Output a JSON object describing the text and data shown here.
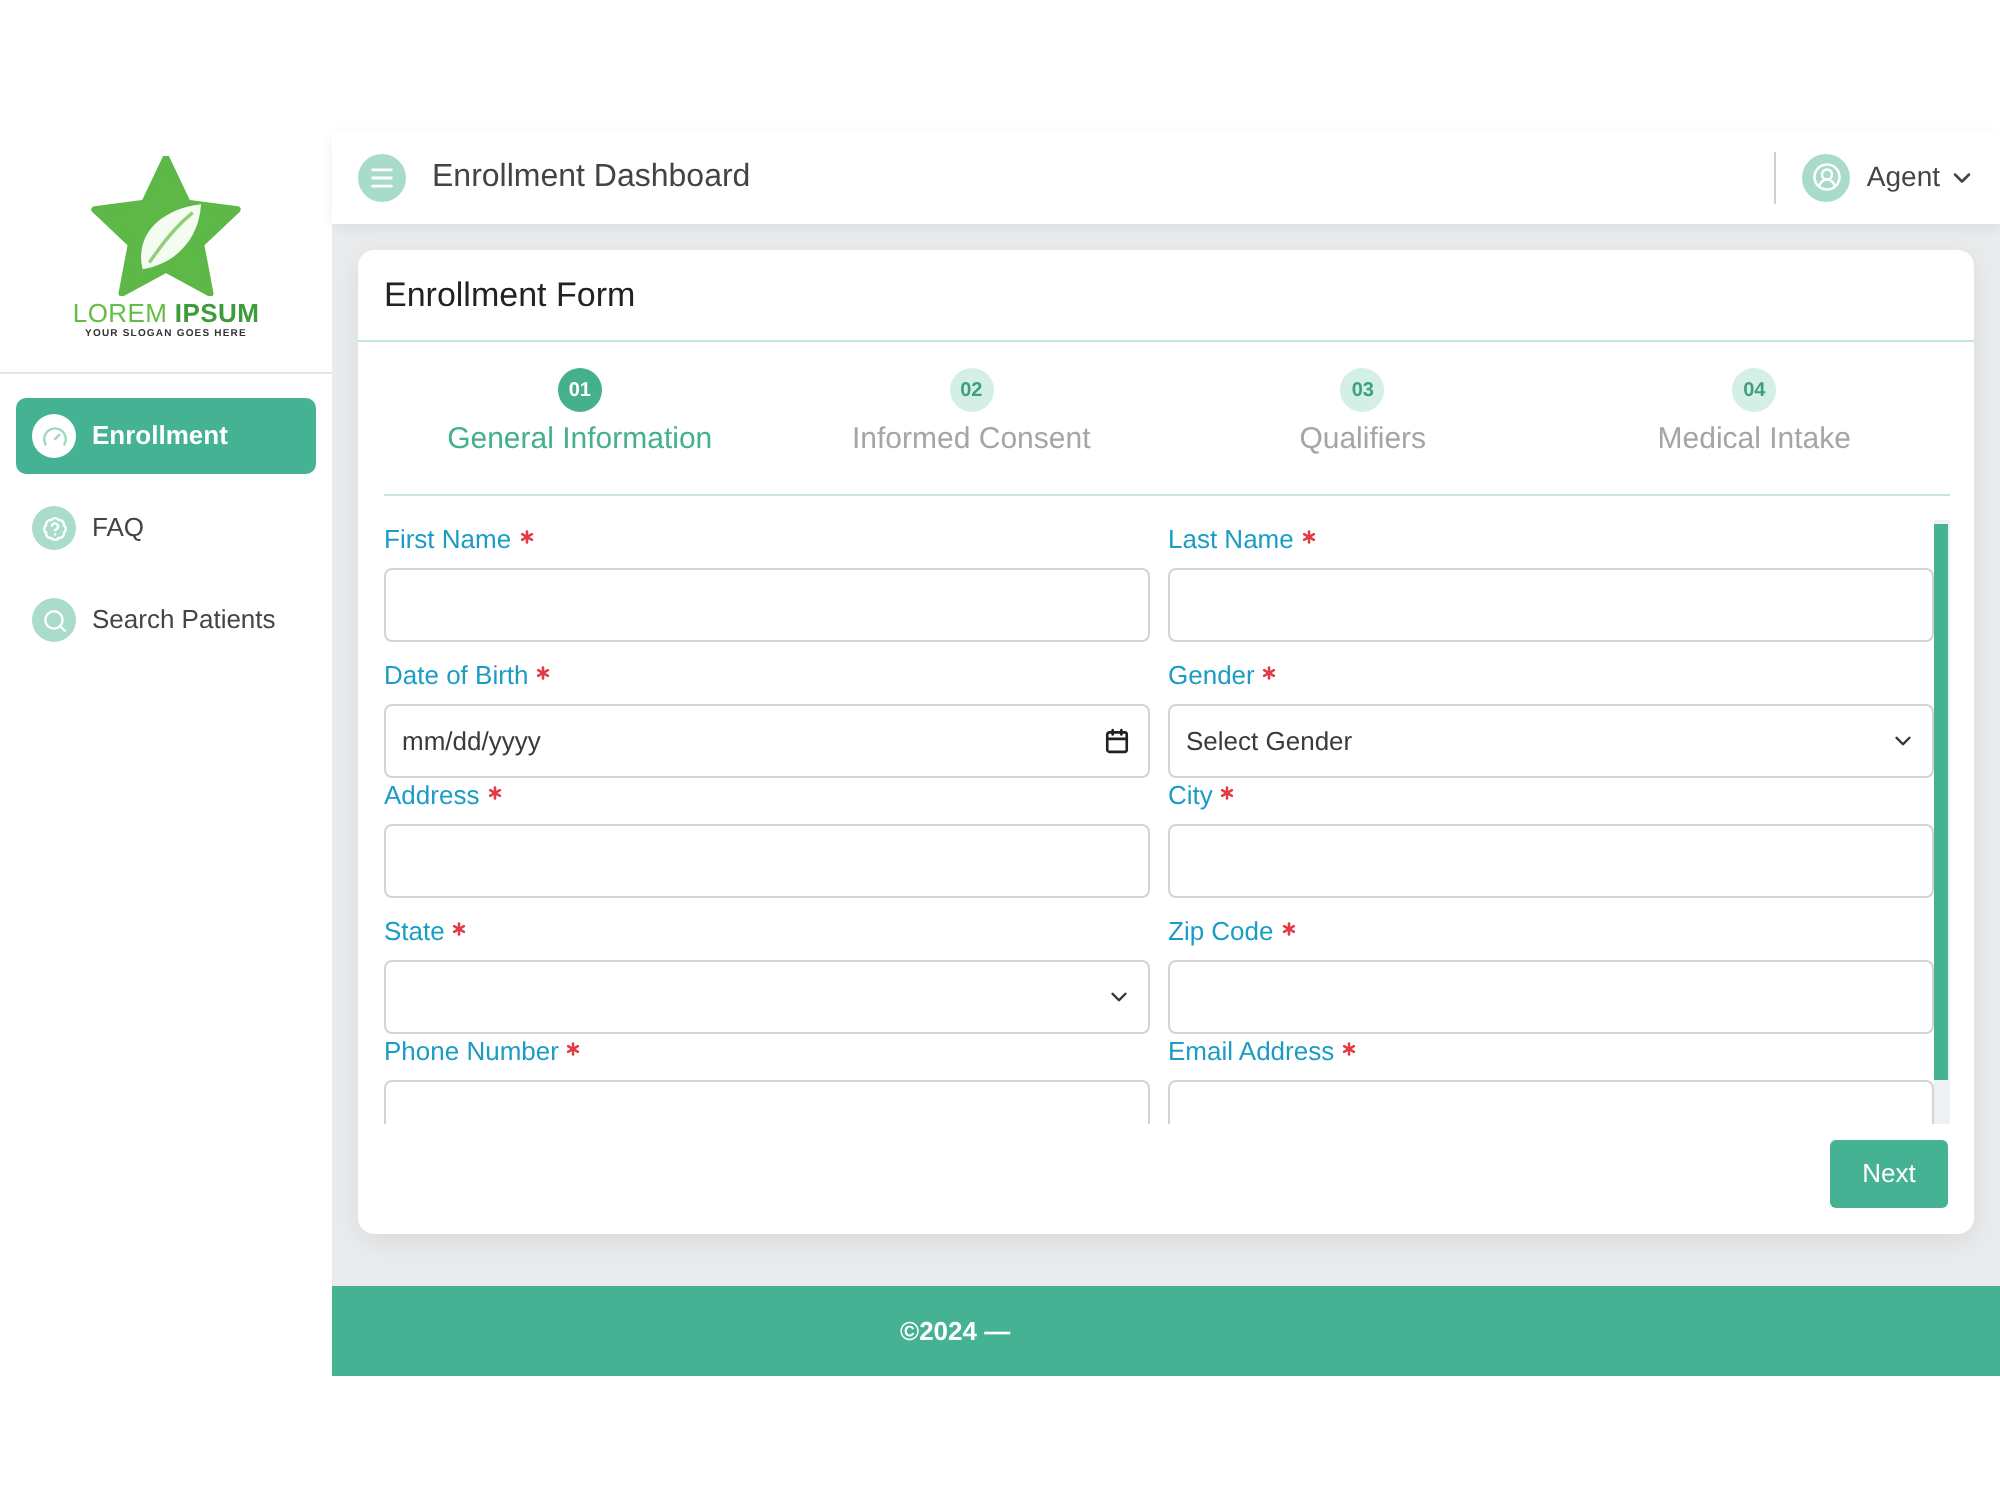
{
  "sidebar": {
    "logo": {
      "words": [
        "LOREM",
        "IPSUM"
      ],
      "slogan": "YOUR SLOGAN GOES HERE"
    },
    "items": [
      {
        "label": "Enrollment",
        "selected": true
      },
      {
        "label": "FAQ",
        "selected": false
      },
      {
        "label": "Search Patients",
        "selected": false
      }
    ]
  },
  "header": {
    "title": "Enrollment Dashboard",
    "user": "Agent"
  },
  "form": {
    "title": "Enrollment Form",
    "steps": [
      {
        "number": "01",
        "label": "General Information",
        "selected": true
      },
      {
        "number": "02",
        "label": "Informed Consent",
        "selected": false
      },
      {
        "number": "03",
        "label": "Qualifiers",
        "selected": false
      },
      {
        "number": "04",
        "label": "Medical Intake",
        "selected": false
      }
    ],
    "fields": [
      {
        "label": "First Name",
        "required": true,
        "kind": "text"
      },
      {
        "label": "Last Name",
        "required": true,
        "kind": "text"
      },
      {
        "label": "Date of Birth",
        "required": true,
        "kind": "date",
        "placeholder": "mm/dd/yyyy"
      },
      {
        "label": "Gender",
        "required": true,
        "kind": "select",
        "value": "Select Gender"
      },
      {
        "label": "Address",
        "required": true,
        "kind": "text"
      },
      {
        "label": "City",
        "required": true,
        "kind": "text"
      },
      {
        "label": "State",
        "required": true,
        "kind": "select"
      },
      {
        "label": "Zip Code",
        "required": true,
        "kind": "text"
      },
      {
        "label": "Phone Number",
        "required": true,
        "kind": "text"
      },
      {
        "label": "Email Address",
        "required": true,
        "kind": "text"
      }
    ],
    "next_button": "Next"
  },
  "footer": {
    "text": "©2024 —"
  }
}
